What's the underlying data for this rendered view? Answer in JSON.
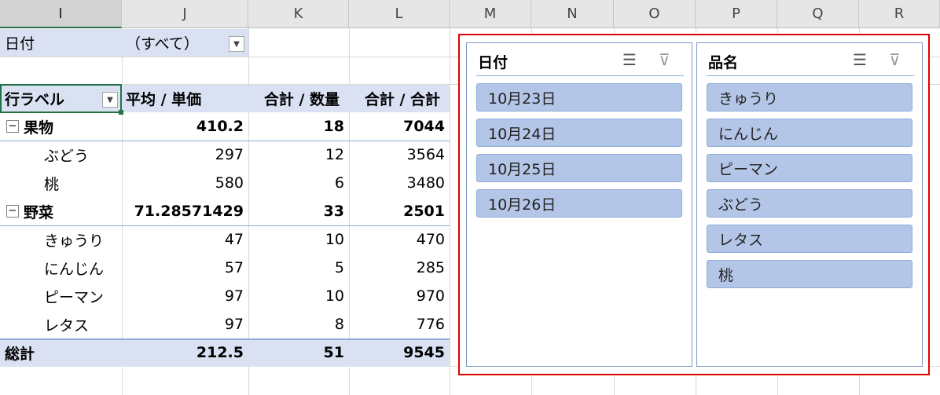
{
  "columns": [
    "I",
    "J",
    "K",
    "L",
    "M",
    "N",
    "O",
    "P",
    "Q",
    "R"
  ],
  "filter": {
    "label": "日付",
    "value": "（すべて）"
  },
  "pivot": {
    "headers": [
      "行ラベル",
      "平均 / 単価",
      "合計 / 数量",
      "合計 / 合計"
    ],
    "rows": [
      {
        "label": "果物",
        "avg": "410.2",
        "qty": "18",
        "total": "7044",
        "type": "group"
      },
      {
        "label": "ぶどう",
        "avg": "297",
        "qty": "12",
        "total": "3564",
        "type": "item"
      },
      {
        "label": "桃",
        "avg": "580",
        "qty": "6",
        "total": "3480",
        "type": "item"
      },
      {
        "label": "野菜",
        "avg": "71.28571429",
        "qty": "33",
        "total": "2501",
        "type": "group"
      },
      {
        "label": "きゅうり",
        "avg": "47",
        "qty": "10",
        "total": "470",
        "type": "item"
      },
      {
        "label": "にんじん",
        "avg": "57",
        "qty": "5",
        "total": "285",
        "type": "item"
      },
      {
        "label": "ピーマン",
        "avg": "97",
        "qty": "10",
        "total": "970",
        "type": "item"
      },
      {
        "label": "レタス",
        "avg": "97",
        "qty": "8",
        "total": "776",
        "type": "item"
      }
    ],
    "grand_total": {
      "label": "総計",
      "avg": "212.5",
      "qty": "51",
      "total": "9545"
    }
  },
  "slicers": [
    {
      "title": "日付",
      "items": [
        "10月23日",
        "10月24日",
        "10月25日",
        "10月26日"
      ]
    },
    {
      "title": "品名",
      "items": [
        "きゅうり",
        "にんじん",
        "ピーマン",
        "ぶどう",
        "レタス",
        "桃"
      ]
    }
  ],
  "colors": {
    "highlight_border": "#e00000",
    "band": "#d9e1f2",
    "slicer_item": "#b4c6e7"
  }
}
